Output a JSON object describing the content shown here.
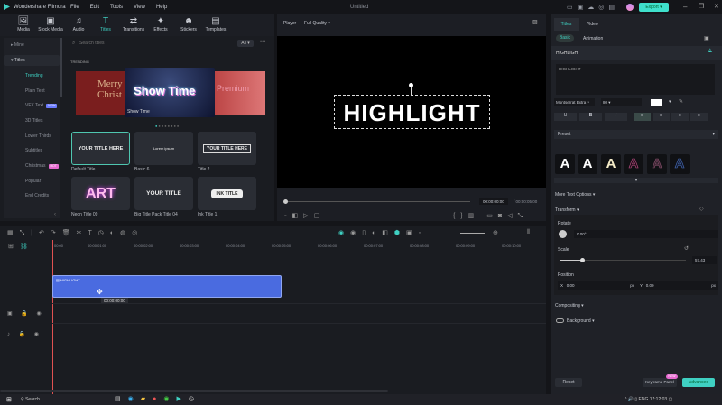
{
  "app": {
    "title": "Wondershare Filmora",
    "menu": [
      "File",
      "Edit",
      "Tools",
      "View",
      "Help"
    ],
    "project": "Untitled",
    "export_label": "Export",
    "accent": "#3fd0c2"
  },
  "toolbar": [
    {
      "label": "Media",
      "icon": "🖼"
    },
    {
      "label": "Stock Media",
      "icon": "▣"
    },
    {
      "label": "Audio",
      "icon": "♫"
    },
    {
      "label": "Titles",
      "icon": "T"
    },
    {
      "label": "Transitions",
      "icon": "⇄"
    },
    {
      "label": "Effects",
      "icon": "✦"
    },
    {
      "label": "Stickers",
      "icon": "☻"
    },
    {
      "label": "Templates",
      "icon": "▤"
    }
  ],
  "sidebar": {
    "mine": "Mine",
    "titles": "Titles",
    "items": [
      "Trending",
      "Plain Text",
      "VFX Text",
      "3D Titles",
      "Lower Thirds",
      "Subtitles",
      "Christmas",
      "Popular",
      "End Credits"
    ],
    "vfx_badge": "NEW",
    "christmas_badge": "HOT"
  },
  "search": {
    "placeholder": "Search titles",
    "filter": "All"
  },
  "trending": {
    "heading": "TRENDING",
    "banner_title": "Show Time",
    "banner_caption": "Show Time",
    "left_text": "Merry Christ",
    "right_text": "Premium"
  },
  "cards": [
    {
      "label": "Default Title",
      "preview": "YOUR TITLE HERE"
    },
    {
      "label": "Basic 6",
      "preview": "Lorem ipsum"
    },
    {
      "label": "Title 2",
      "preview": "YOUR TITLE HERE"
    },
    {
      "label": "Neon Title 09",
      "preview": "ART"
    },
    {
      "label": "Big Title Pack Title 04",
      "preview": "YOUR TITLE"
    },
    {
      "label": "Ink Title 1",
      "preview": "INK TITLE"
    }
  ],
  "player": {
    "label": "Player",
    "quality": "Full Quality",
    "canvas_text": "HIGHLIGHT",
    "current_time": "00:00:00:00",
    "total_time": "/ 00:00:05:00"
  },
  "right": {
    "tabs": [
      "Titles",
      "Video"
    ],
    "subtabs": [
      "Basic",
      "Animation"
    ],
    "section": "HIGHLIGHT",
    "text_value": "HIGHLIGHT",
    "font": "Montserrat Extra",
    "size": "80",
    "preset_label": "Preset",
    "more_text": "More Text Options",
    "transform": "Transform",
    "rotate": "Rotate",
    "rotate_value": "0.00°",
    "scale": "Scale",
    "scale_value": "57.43",
    "scale_fraction": 0.18,
    "position": "Position",
    "x_label": "X",
    "x_value": "0.00",
    "y_label": "Y",
    "y_value": "0.00",
    "px": "px",
    "compositing": "Compositing",
    "background": "Background",
    "reset": "Reset",
    "keyframe": "Keyframe Panel",
    "keyframe_badge": "NEW",
    "advanced": "Advanced"
  },
  "timeline": {
    "ticks": [
      "00:00",
      "00:00:01:00",
      "00:00:02:00",
      "00:00:03:00",
      "00:00:04:00",
      "00:00:05:00",
      "00:00:06:00",
      "00:00:07:00",
      "00:00:08:00",
      "00:00:09:00",
      "00:00:10:00"
    ],
    "clip_label": "HIGHLIGHT",
    "tooltip": "00:00:00:00"
  },
  "taskbar": {
    "search": "Search",
    "lang": "ENG",
    "time": "17:12:03"
  }
}
